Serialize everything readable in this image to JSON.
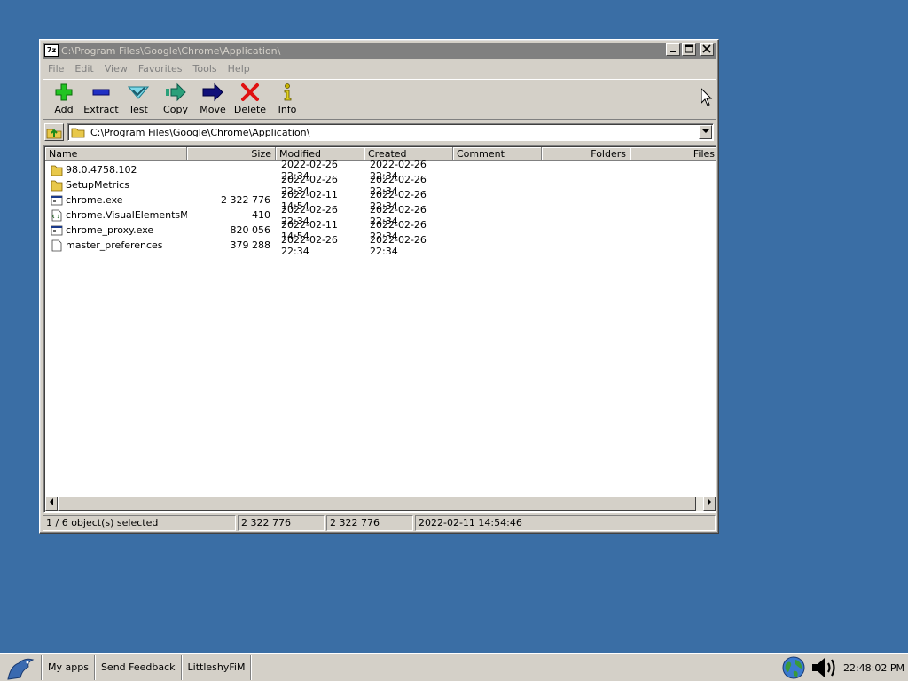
{
  "window": {
    "title": "C:\\Program Files\\Google\\Chrome\\Application\\",
    "app_icon_text": "7z"
  },
  "menu": [
    "File",
    "Edit",
    "View",
    "Favorites",
    "Tools",
    "Help"
  ],
  "toolbar": {
    "add": "Add",
    "extract": "Extract",
    "test": "Test",
    "copy": "Copy",
    "move": "Move",
    "delete": "Delete",
    "info": "Info"
  },
  "address": {
    "path": "C:\\Program Files\\Google\\Chrome\\Application\\"
  },
  "columns": {
    "name": "Name",
    "size": "Size",
    "modified": "Modified",
    "created": "Created",
    "comment": "Comment",
    "folders": "Folders",
    "files": "Files"
  },
  "files": [
    {
      "name": "98.0.4758.102",
      "size": "",
      "modified": "2022-02-26 22:34",
      "created": "2022-02-26 22:34",
      "icon": "folder-icon"
    },
    {
      "name": "SetupMetrics",
      "size": "",
      "modified": "2022-02-26 22:34",
      "created": "2022-02-26 22:34",
      "icon": "folder-icon"
    },
    {
      "name": "chrome.exe",
      "size": "2 322 776",
      "modified": "2022-02-11 14:54",
      "created": "2022-02-26 22:34",
      "icon": "exe-icon"
    },
    {
      "name": "chrome.VisualElementsMa...",
      "size": "410",
      "modified": "2022-02-26 22:34",
      "created": "2022-02-26 22:34",
      "icon": "xml-file-icon"
    },
    {
      "name": "chrome_proxy.exe",
      "size": "820 056",
      "modified": "2022-02-11 14:54",
      "created": "2022-02-26 22:34",
      "icon": "exe-icon"
    },
    {
      "name": "master_preferences",
      "size": "379 288",
      "modified": "2022-02-26 22:34",
      "created": "2022-02-26 22:34",
      "icon": "file-icon"
    }
  ],
  "status": {
    "selection": "1 / 6 object(s) selected",
    "size1": "2 322 776",
    "size2": "2 322 776",
    "date": "2022-02-11 14:54:46"
  },
  "taskbar": {
    "items": [
      "My apps",
      "Send Feedback",
      "LittleshyFiM"
    ],
    "clock": "22:48:02 PM"
  }
}
